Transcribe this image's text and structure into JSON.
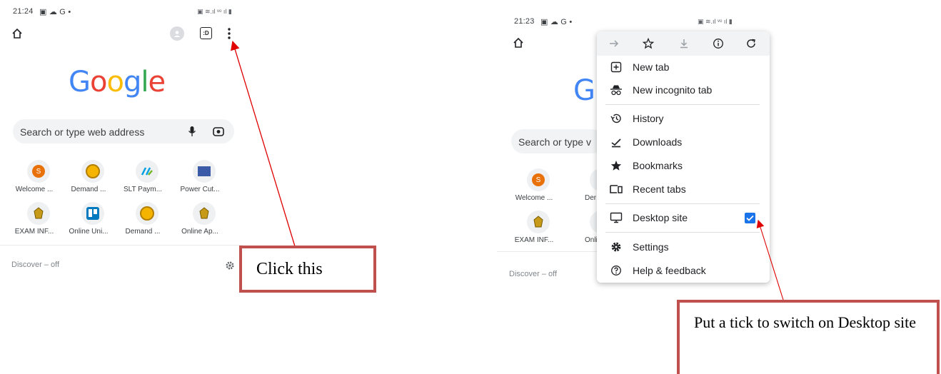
{
  "left": {
    "status": {
      "time": "21:24",
      "indicators": "▣ ☁ G •",
      "right": "▣ ≋.ıl ᵛᵒ ıl ▮"
    },
    "toolbar": {
      "home_icon": "home-icon",
      "tabs_count": ":D",
      "menu_icon": "more-vert-icon"
    },
    "logo": {
      "letters": [
        "G",
        "o",
        "o",
        "g",
        "l",
        "e"
      ],
      "colors": [
        "#4285F4",
        "#EA4335",
        "#FBBC05",
        "#4285F4",
        "#34A853",
        "#EA4335"
      ]
    },
    "search": {
      "placeholder": "Search or type web address"
    },
    "tiles": [
      {
        "label": "Welcome ...",
        "badge": "S"
      },
      {
        "label": "Demand ...",
        "badge": ""
      },
      {
        "label": "SLT Paym...",
        "badge": ""
      },
      {
        "label": "Power Cut...",
        "badge": ""
      },
      {
        "label": "EXAM INF...",
        "badge": ""
      },
      {
        "label": "Online Uni...",
        "badge": ""
      },
      {
        "label": "Demand ...",
        "badge": ""
      },
      {
        "label": "Online Ap...",
        "badge": ""
      }
    ],
    "discover": "Discover – off",
    "callout": "Click this"
  },
  "right": {
    "status": {
      "time": "21:23",
      "indicators": "▣ ☁ G •",
      "right": "▣ ≋.ıl ᵛᵒ ıl ▮"
    },
    "search": {
      "placeholder_visible": "Search or type v"
    },
    "tiles": [
      {
        "label": "Welcome ...",
        "badge": "S"
      },
      {
        "label": "Der",
        "badge": ""
      },
      {
        "label": "EXAM INF...",
        "badge": ""
      },
      {
        "label": "Onli",
        "badge": ""
      }
    ],
    "discover": "Discover – off",
    "menu": {
      "top_icons": [
        "forward-icon",
        "star-icon",
        "download-icon",
        "info-icon",
        "refresh-icon"
      ],
      "items": [
        {
          "label": "New tab",
          "icon": "new-tab-icon"
        },
        {
          "label": "New incognito tab",
          "icon": "incognito-icon"
        },
        {
          "label": "History",
          "icon": "history-icon"
        },
        {
          "label": "Downloads",
          "icon": "downloads-icon"
        },
        {
          "label": "Bookmarks",
          "icon": "bookmarks-icon"
        },
        {
          "label": "Recent tabs",
          "icon": "recent-tabs-icon"
        },
        {
          "label": "Desktop site",
          "icon": "desktop-icon",
          "checked": true
        },
        {
          "label": "Settings",
          "icon": "settings-icon"
        },
        {
          "label": "Help & feedback",
          "icon": "help-icon"
        }
      ]
    },
    "callout": "Put a tick to switch on Desktop site"
  },
  "colors": {
    "accent": "#1a73e8",
    "arrow": "#e00000",
    "callout_border": "#c0504d"
  }
}
